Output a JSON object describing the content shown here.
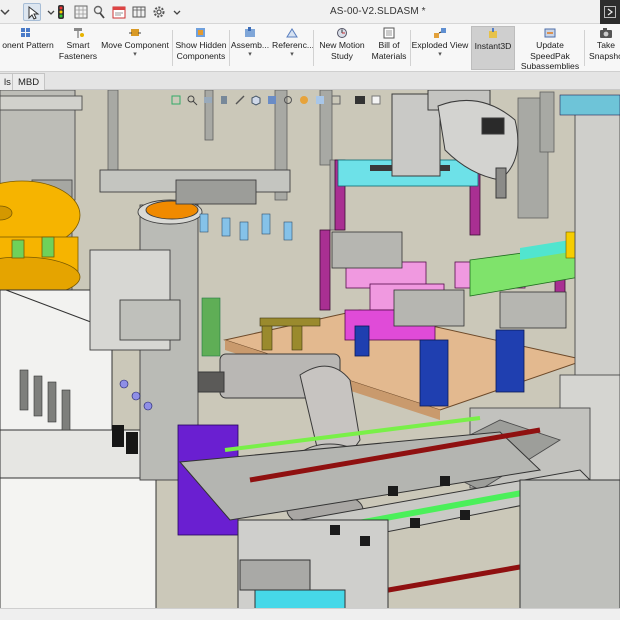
{
  "window": {
    "document_title": "AS-00-V2.SLDASM *"
  },
  "quick_access": [
    {
      "name": "expand-menu-icon"
    },
    {
      "name": "new-document-icon"
    },
    {
      "name": "select-pointer-icon"
    },
    {
      "name": "traffic-light-icon"
    },
    {
      "name": "grid-icon"
    },
    {
      "name": "rebuild-icon"
    },
    {
      "name": "file-properties-icon"
    },
    {
      "name": "table-icon"
    },
    {
      "name": "options-gear-icon"
    }
  ],
  "ribbon": {
    "buttons": [
      {
        "id": "component-pattern",
        "label": "onent Pattern",
        "icon": "pattern-icon"
      },
      {
        "id": "smart-fasteners",
        "label": "Smart\nFasteners",
        "icon": "fastener-icon"
      },
      {
        "id": "move-component",
        "label": "Move Component",
        "icon": "move-icon"
      },
      {
        "id": "show-hidden-components",
        "label": "Show Hidden\nComponents",
        "icon": "show-hidden-icon"
      },
      {
        "id": "assembly",
        "label": "Assemb...",
        "icon": "assembly-icon"
      },
      {
        "id": "reference",
        "label": "Referenc...",
        "icon": "reference-icon"
      },
      {
        "id": "new-motion-study",
        "label": "New Motion\nStudy",
        "icon": "motion-study-icon"
      },
      {
        "id": "bill-of-materials",
        "label": "Bill of\nMaterials",
        "icon": "bom-icon"
      },
      {
        "id": "exploded-view",
        "label": "Exploded View",
        "icon": "exploded-view-icon"
      },
      {
        "id": "instant3d",
        "label": "Instant3D",
        "icon": "instant3d-icon",
        "active": true
      },
      {
        "id": "update-speedpak",
        "label": "Update SpeedPak\nSubassemblies",
        "icon": "speedpak-icon"
      },
      {
        "id": "take-snapshot",
        "label": "Take\nSnapsho",
        "icon": "camera-icon"
      }
    ]
  },
  "tabs": [
    {
      "label": "ls"
    },
    {
      "label": "MBD"
    }
  ],
  "colors": {
    "accent_blue": "#1f3fb0",
    "magenta": "#e04bd8",
    "cyan": "#1ec8d8",
    "orange": "#f6b400",
    "green": "#44e34a",
    "conveyor_purple": "#6a1fd1"
  }
}
